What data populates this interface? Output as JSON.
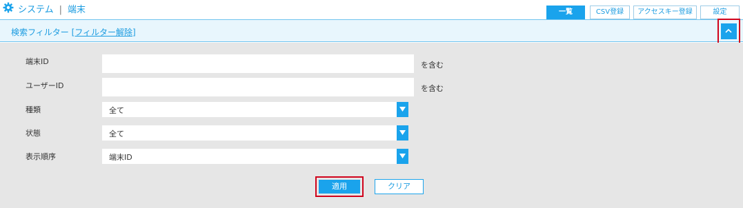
{
  "header": {
    "icon": "gear-icon",
    "section": "システム",
    "separator": "|",
    "page": "端末"
  },
  "tabs": [
    {
      "label": "一覧",
      "active": true
    },
    {
      "label": "CSV登録",
      "active": false
    },
    {
      "label": "アクセスキー登録",
      "active": false
    },
    {
      "label": "設定",
      "active": false
    }
  ],
  "filter": {
    "title": "検索フィルター",
    "clear_link": "[フィルター解除]",
    "toggle_icon": "chevron-up-icon"
  },
  "form": {
    "terminal_id": {
      "label": "端末ID",
      "value": "",
      "suffix": "を含む"
    },
    "user_id": {
      "label": "ユーザーID",
      "value": "",
      "suffix": "を含む"
    },
    "type": {
      "label": "種類",
      "selected": "全て"
    },
    "status": {
      "label": "状態",
      "selected": "全て"
    },
    "sort_order": {
      "label": "表示順序",
      "selected": "端末ID"
    }
  },
  "buttons": {
    "apply": "適用",
    "clear": "クリア"
  },
  "colors": {
    "accent": "#1aa3ec",
    "highlight": "#d0021b",
    "form_bg": "#e6e6e6",
    "filter_bar_bg": "#e8f6fd"
  }
}
